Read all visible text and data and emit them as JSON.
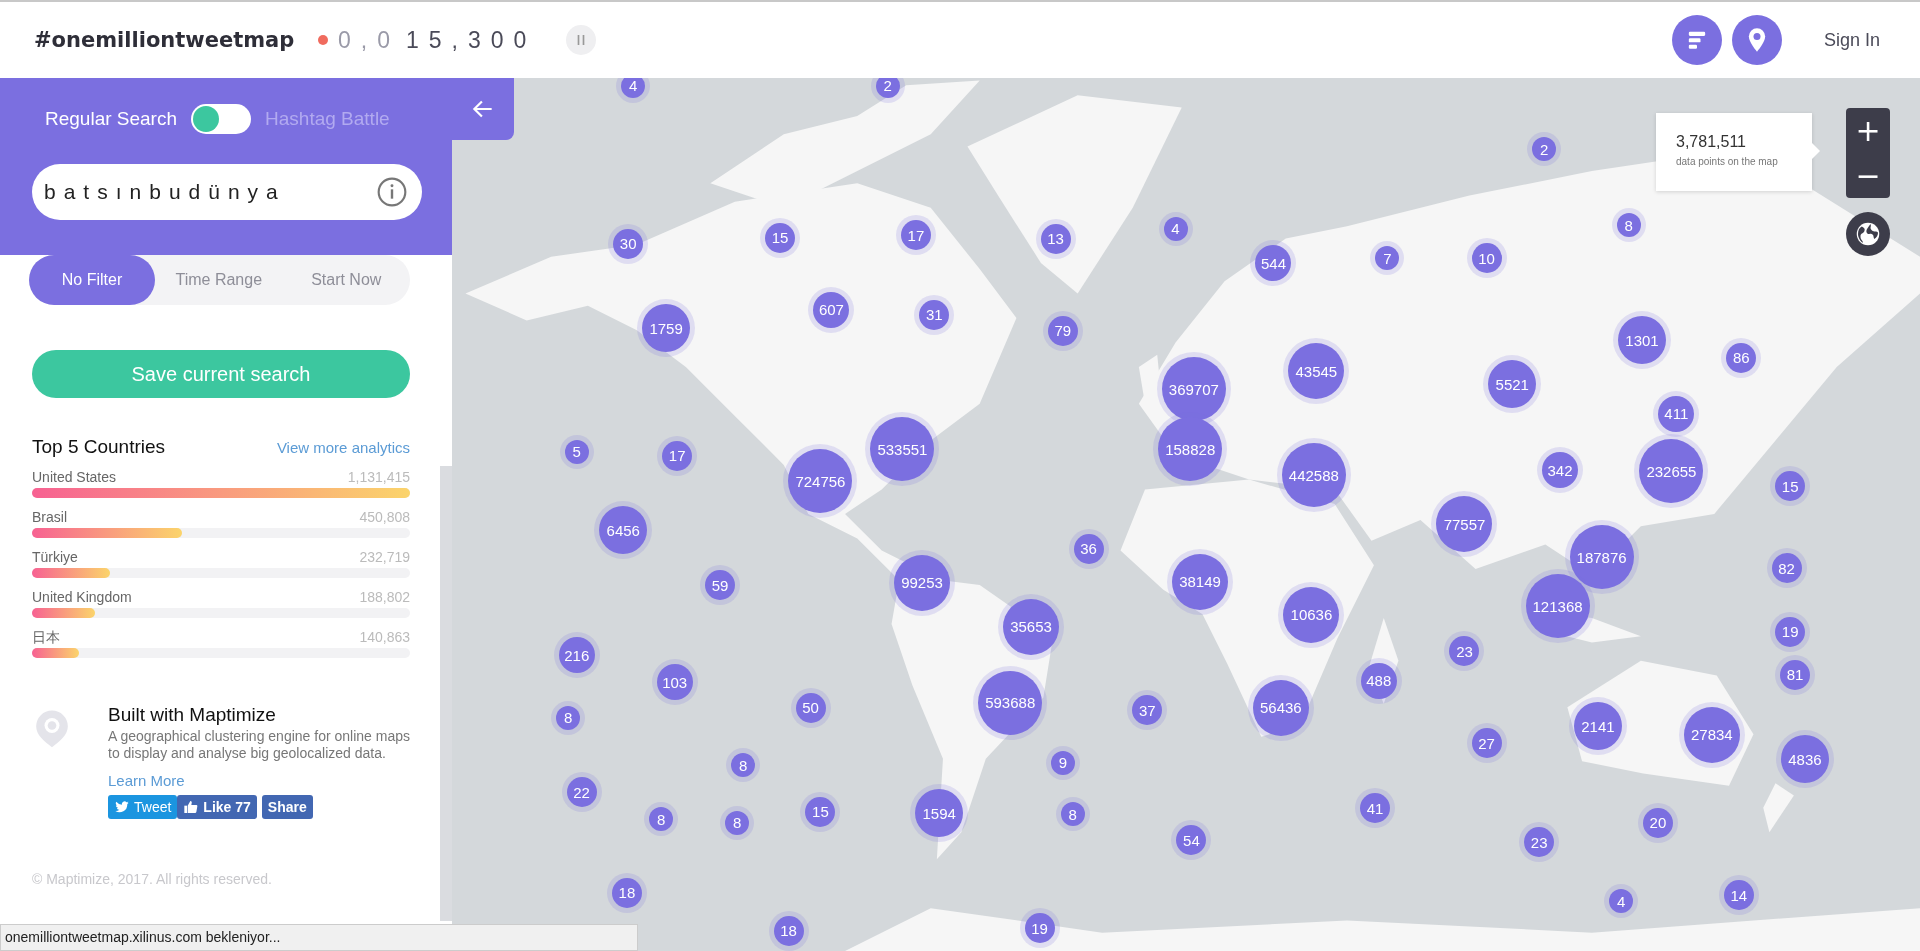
{
  "header": {
    "title": "#onemilliontweetmap",
    "counter_dim": "0,0",
    "counter": "15,300",
    "sign_in": "Sign In"
  },
  "sidebar": {
    "mode_toggle": {
      "left_label": "Regular Search",
      "right_label": "Hashtag Battle",
      "on": false
    },
    "search": {
      "value": "batsınbudünya"
    },
    "filters": [
      {
        "label": "No Filter",
        "selected": true
      },
      {
        "label": "Time Range",
        "selected": false
      },
      {
        "label": "Start Now",
        "selected": false
      }
    ],
    "save_button": "Save current search",
    "top_countries": {
      "title": "Top 5 Countries",
      "link": "View more analytics",
      "rows": [
        {
          "name": "United States",
          "count": "1,131,415",
          "level": 1
        },
        {
          "name": "Brasil",
          "count": "450,808",
          "level": 0.398
        },
        {
          "name": "Türkiye",
          "count": "232,719",
          "level": 0.206
        },
        {
          "name": "United Kingdom",
          "count": "188,802",
          "level": 0.167
        },
        {
          "name": "日本",
          "count": "140,863",
          "level": 0.124
        }
      ]
    },
    "promo": {
      "title": "Built with Maptimize",
      "text": "A geographical clustering engine for online maps to display and analyse big geolocalized data.",
      "link": "Learn More"
    },
    "social": [
      {
        "kind": "tweet",
        "label": "Tweet"
      },
      {
        "kind": "like",
        "label": "Like 77"
      },
      {
        "kind": "share",
        "label": "Share"
      }
    ],
    "footer": "© Maptimize, 2017. All rights reserved."
  },
  "map": {
    "tooltip": {
      "value": "3,781,511",
      "caption": "data points on the map"
    },
    "zoom_in": "+",
    "zoom_out": "−",
    "clusters": [
      {
        "count": "4"
      },
      {
        "count": "2"
      },
      {
        "count": "30"
      },
      {
        "count": "15"
      },
      {
        "count": "17"
      },
      {
        "count": "13"
      },
      {
        "count": "4"
      },
      {
        "count": "544"
      },
      {
        "count": "7"
      },
      {
        "count": "10"
      },
      {
        "count": "2"
      },
      {
        "count": "8"
      },
      {
        "count": "1759"
      },
      {
        "count": "607"
      },
      {
        "count": "31"
      },
      {
        "count": "79"
      },
      {
        "count": "43545"
      },
      {
        "count": "369707"
      },
      {
        "count": "5521"
      },
      {
        "count": "1301"
      },
      {
        "count": "86"
      },
      {
        "count": "411"
      },
      {
        "count": "5"
      },
      {
        "count": "17"
      },
      {
        "count": "533551"
      },
      {
        "count": "724756"
      },
      {
        "count": "158828"
      },
      {
        "count": "442588"
      },
      {
        "count": "342"
      },
      {
        "count": "232655"
      },
      {
        "count": "15"
      },
      {
        "count": "6456"
      },
      {
        "count": "36"
      },
      {
        "count": "77557"
      },
      {
        "count": "187876"
      },
      {
        "count": "82"
      },
      {
        "count": "59"
      },
      {
        "count": "99253"
      },
      {
        "count": "38149"
      },
      {
        "count": "121368"
      },
      {
        "count": "35653"
      },
      {
        "count": "10636"
      },
      {
        "count": "19"
      },
      {
        "count": "216"
      },
      {
        "count": "103"
      },
      {
        "count": "23"
      },
      {
        "count": "81"
      },
      {
        "count": "8"
      },
      {
        "count": "50"
      },
      {
        "count": "593688"
      },
      {
        "count": "37"
      },
      {
        "count": "56436"
      },
      {
        "count": "488"
      },
      {
        "count": "27"
      },
      {
        "count": "2141"
      },
      {
        "count": "27834"
      },
      {
        "count": "4836"
      },
      {
        "count": "8"
      },
      {
        "count": "9"
      },
      {
        "count": "22"
      },
      {
        "count": "8"
      },
      {
        "count": "8"
      },
      {
        "count": "15"
      },
      {
        "count": "1594"
      },
      {
        "count": "8"
      },
      {
        "count": "41"
      },
      {
        "count": "54"
      },
      {
        "count": "20"
      },
      {
        "count": "23"
      },
      {
        "count": "18"
      },
      {
        "count": "4"
      },
      {
        "count": "14"
      },
      {
        "count": "18"
      },
      {
        "count": "19"
      }
    ]
  },
  "status_bar": "onemilliontweetmap.xilinus.com bekleniyor..."
}
